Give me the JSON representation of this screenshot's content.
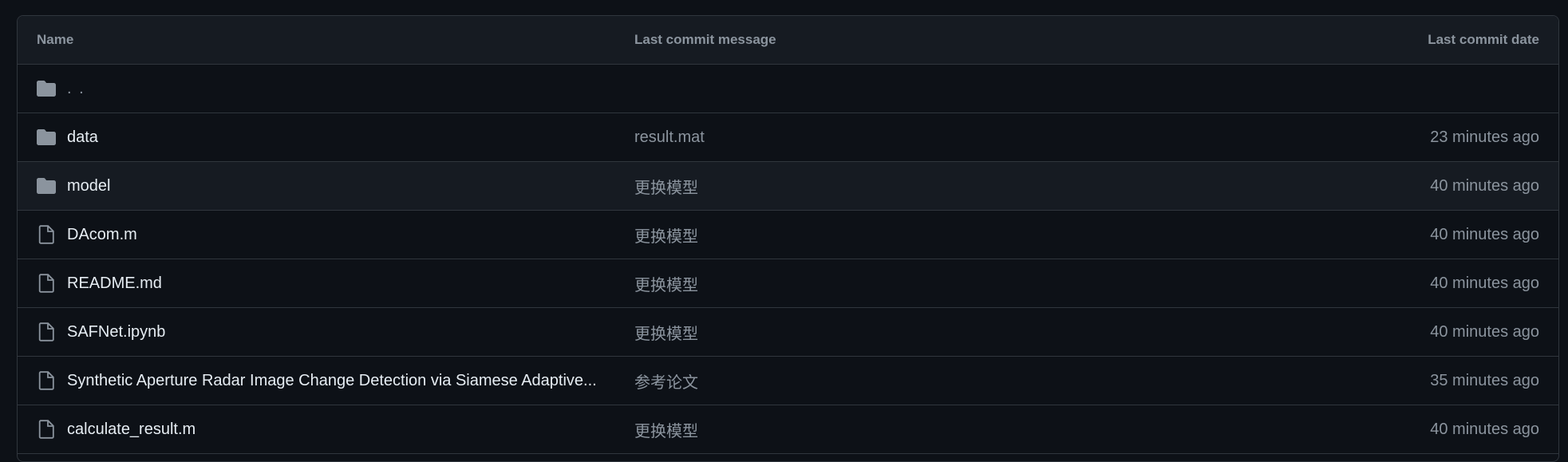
{
  "table": {
    "headers": {
      "name": "Name",
      "message": "Last commit message",
      "date": "Last commit date"
    },
    "parent": {
      "label": ". ."
    },
    "rows": [
      {
        "type": "folder",
        "name": "data",
        "message": "result.mat",
        "date": "23 minutes ago"
      },
      {
        "type": "folder",
        "name": "model",
        "message": "更换模型",
        "date": "40 minutes ago"
      },
      {
        "type": "file",
        "name": "DAcom.m",
        "message": "更换模型",
        "date": "40 minutes ago"
      },
      {
        "type": "file",
        "name": "README.md",
        "message": "更换模型",
        "date": "40 minutes ago"
      },
      {
        "type": "file",
        "name": "SAFNet.ipynb",
        "message": "更换模型",
        "date": "40 minutes ago"
      },
      {
        "type": "file",
        "name": "Synthetic Aperture Radar Image Change Detection via Siamese Adaptive...",
        "message": "参考论文",
        "date": "35 minutes ago"
      },
      {
        "type": "file",
        "name": "calculate_result.m",
        "message": "更换模型",
        "date": "40 minutes ago"
      }
    ]
  },
  "colors": {
    "background": "#0d1117",
    "header_bg": "#161b22",
    "border": "#30363d",
    "text_primary": "#e6edf3",
    "text_muted": "#8b949e",
    "folder_icon": "#8b949e",
    "file_icon": "#8b949e"
  },
  "icons": {
    "folder": "folder-icon",
    "file": "file-icon"
  }
}
